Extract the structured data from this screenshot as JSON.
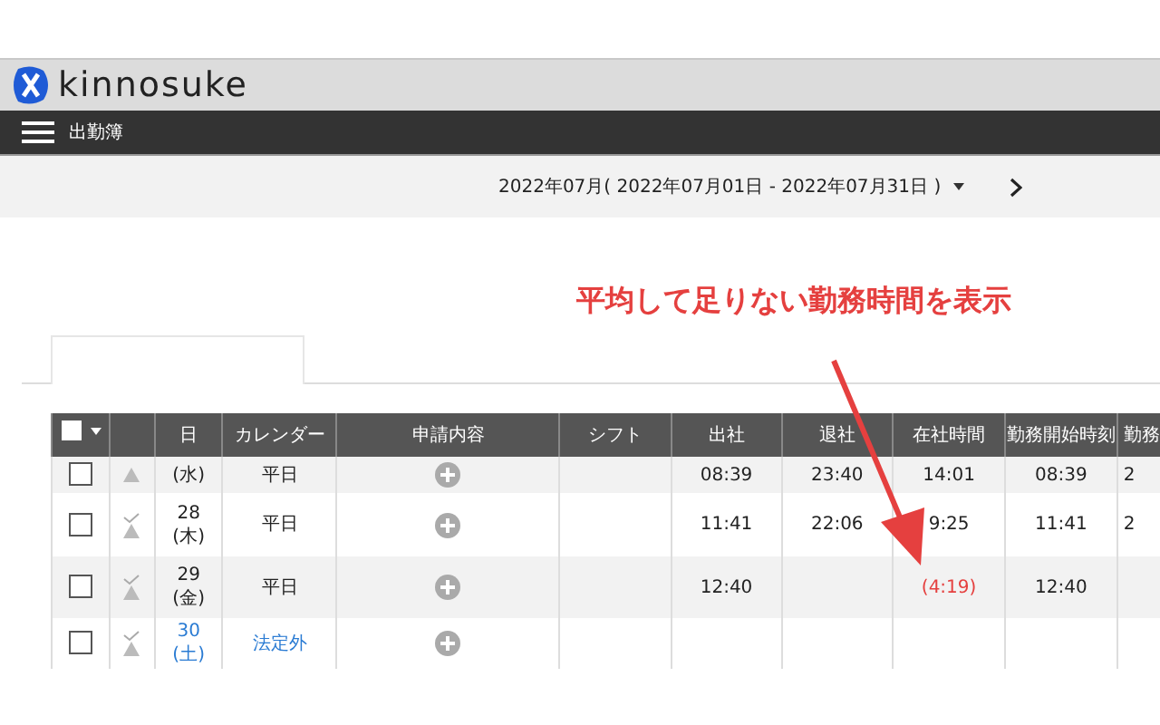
{
  "header": {
    "logo": "kinnosuke"
  },
  "nav": {
    "title": "出勤簿"
  },
  "period": {
    "label": "2022年07月( 2022年07月01日 - 2022年07月31日 )"
  },
  "annotation": {
    "text": "平均して足りない勤務時間を表示"
  },
  "table": {
    "columns": [
      {
        "kind": "select",
        "checked": false
      },
      {
        "kind": "status"
      },
      {
        "kind": "text",
        "label": "日"
      },
      {
        "kind": "text",
        "label": "カレンダー"
      },
      {
        "kind": "text",
        "label": "申請内容"
      },
      {
        "kind": "text",
        "label": "シフト"
      },
      {
        "kind": "text",
        "label": "出社"
      },
      {
        "kind": "text",
        "label": "退社"
      },
      {
        "kind": "text",
        "label": "在社時間"
      },
      {
        "kind": "text",
        "label": "勤務開始時刻"
      },
      {
        "kind": "text",
        "label": "勤務"
      }
    ],
    "rows": [
      {
        "checked": false,
        "approved": false,
        "weekday": "(水)",
        "calendar": "平日",
        "holiday": false,
        "in": "08:39",
        "out": "23:40",
        "stay": "14:01",
        "short": false,
        "start": "08:39",
        "column_11": "2"
      },
      {
        "checked": false,
        "approved": true,
        "date": "28",
        "weekday": "(木)",
        "calendar": "平日",
        "holiday": false,
        "in": "11:41",
        "out": "22:06",
        "stay": "9:25",
        "short": false,
        "start": "11:41",
        "column_11": "2"
      },
      {
        "checked": false,
        "approved": true,
        "date": "29",
        "weekday": "(金)",
        "calendar": "平日",
        "holiday": false,
        "in": "12:40",
        "stay": "(4:19)",
        "short": true,
        "start": "12:40"
      },
      {
        "checked": false,
        "approved": true,
        "date": "30",
        "weekday": "(土)",
        "calendar": "法定外",
        "holiday": true
      }
    ]
  }
}
